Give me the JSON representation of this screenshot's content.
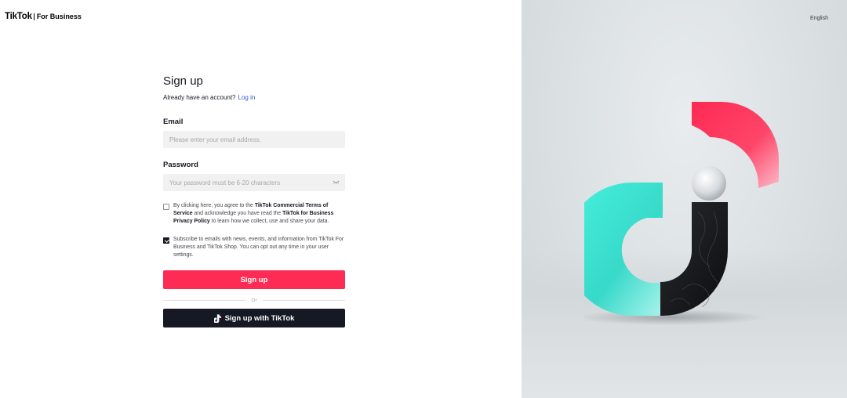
{
  "header": {
    "brand": "TikTok",
    "brand_sub": "For Business"
  },
  "form": {
    "title": "Sign up",
    "already_text": "Already have an account?",
    "login_link": "Log in",
    "email_label": "Email",
    "email_placeholder": "Please enter your email address.",
    "email_value": "",
    "password_label": "Password",
    "password_placeholder": "Your password must be 6-20 characters",
    "password_value": "",
    "terms": {
      "checked": false,
      "t1": "By clicking here, you agree to the ",
      "l1": "TikTok Commercial Terms of Service",
      "t2": " and acknowledge you have read the ",
      "l2": "TikTok for Business Privacy Policy",
      "t3": " to learn how we collect, use and share your data."
    },
    "subscribe": {
      "checked": true,
      "text": "Subscribe to emails with news, events, and information from TikTok For Business and TikTok Shop. You can opt out any time in your user settings."
    },
    "signup_button": "Sign up",
    "divider_text": "Or",
    "tiktok_button": "Sign up with TikTok"
  },
  "right_panel": {
    "language": "English"
  },
  "colors": {
    "primary": "#fe2c55",
    "dark": "#161823",
    "link": "#2b5bd6",
    "input_bg": "#f1f1f2",
    "art_cyan": "#25f4ee",
    "art_red": "#fe2c55"
  },
  "icons": {
    "password_toggle": "eye-off-icon",
    "tiktok_logo": "tiktok-note-icon",
    "checkbox_checked": "check-icon"
  }
}
